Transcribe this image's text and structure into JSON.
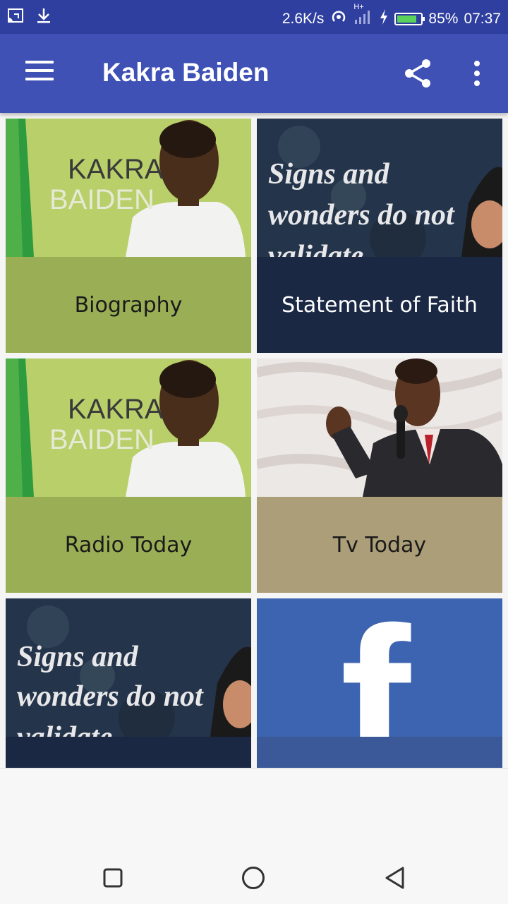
{
  "status_bar": {
    "net_speed": "2.6K/s",
    "network_type": "H+",
    "battery_percent": "85%",
    "battery_level": 0.85,
    "time": "07:37",
    "icons": [
      "screen-cast-icon",
      "download-icon",
      "hotspot-icon",
      "signal-icon",
      "charging-icon",
      "battery-icon"
    ]
  },
  "app_bar": {
    "title": "Kakra Baiden",
    "icons": [
      "menu-icon",
      "share-icon",
      "more-vert-icon"
    ]
  },
  "tiles": [
    {
      "label": "Biography",
      "image_text": [
        "KAKRA",
        "BAIDEN"
      ],
      "bg": "#9aaf55",
      "text_color": "#1a1a1a"
    },
    {
      "label": "Statement of Faith",
      "image_text": [
        "Signs and",
        "wonders do not",
        "validate"
      ],
      "bg": "#1b2844",
      "text_color": "#ffffff"
    },
    {
      "label": "Radio Today",
      "image_text": [
        "KAKRA",
        "BAIDEN"
      ],
      "bg": "#9aaf55",
      "text_color": "#1a1a1a"
    },
    {
      "label": "Tv Today",
      "image_text": [],
      "bg": "#ab9e78",
      "text_color": "#1a1a1a"
    },
    {
      "label": "",
      "image_text": [
        "Signs and",
        "wonders do not",
        "validate"
      ],
      "bg": "#1b2844",
      "text_color": "#ffffff"
    },
    {
      "label": "",
      "image_text": [
        "f"
      ],
      "bg": "#3b5998",
      "text_color": "#ffffff"
    }
  ],
  "nav_bar": {
    "icons": [
      "recents-square-icon",
      "home-circle-icon",
      "back-triangle-icon"
    ]
  }
}
